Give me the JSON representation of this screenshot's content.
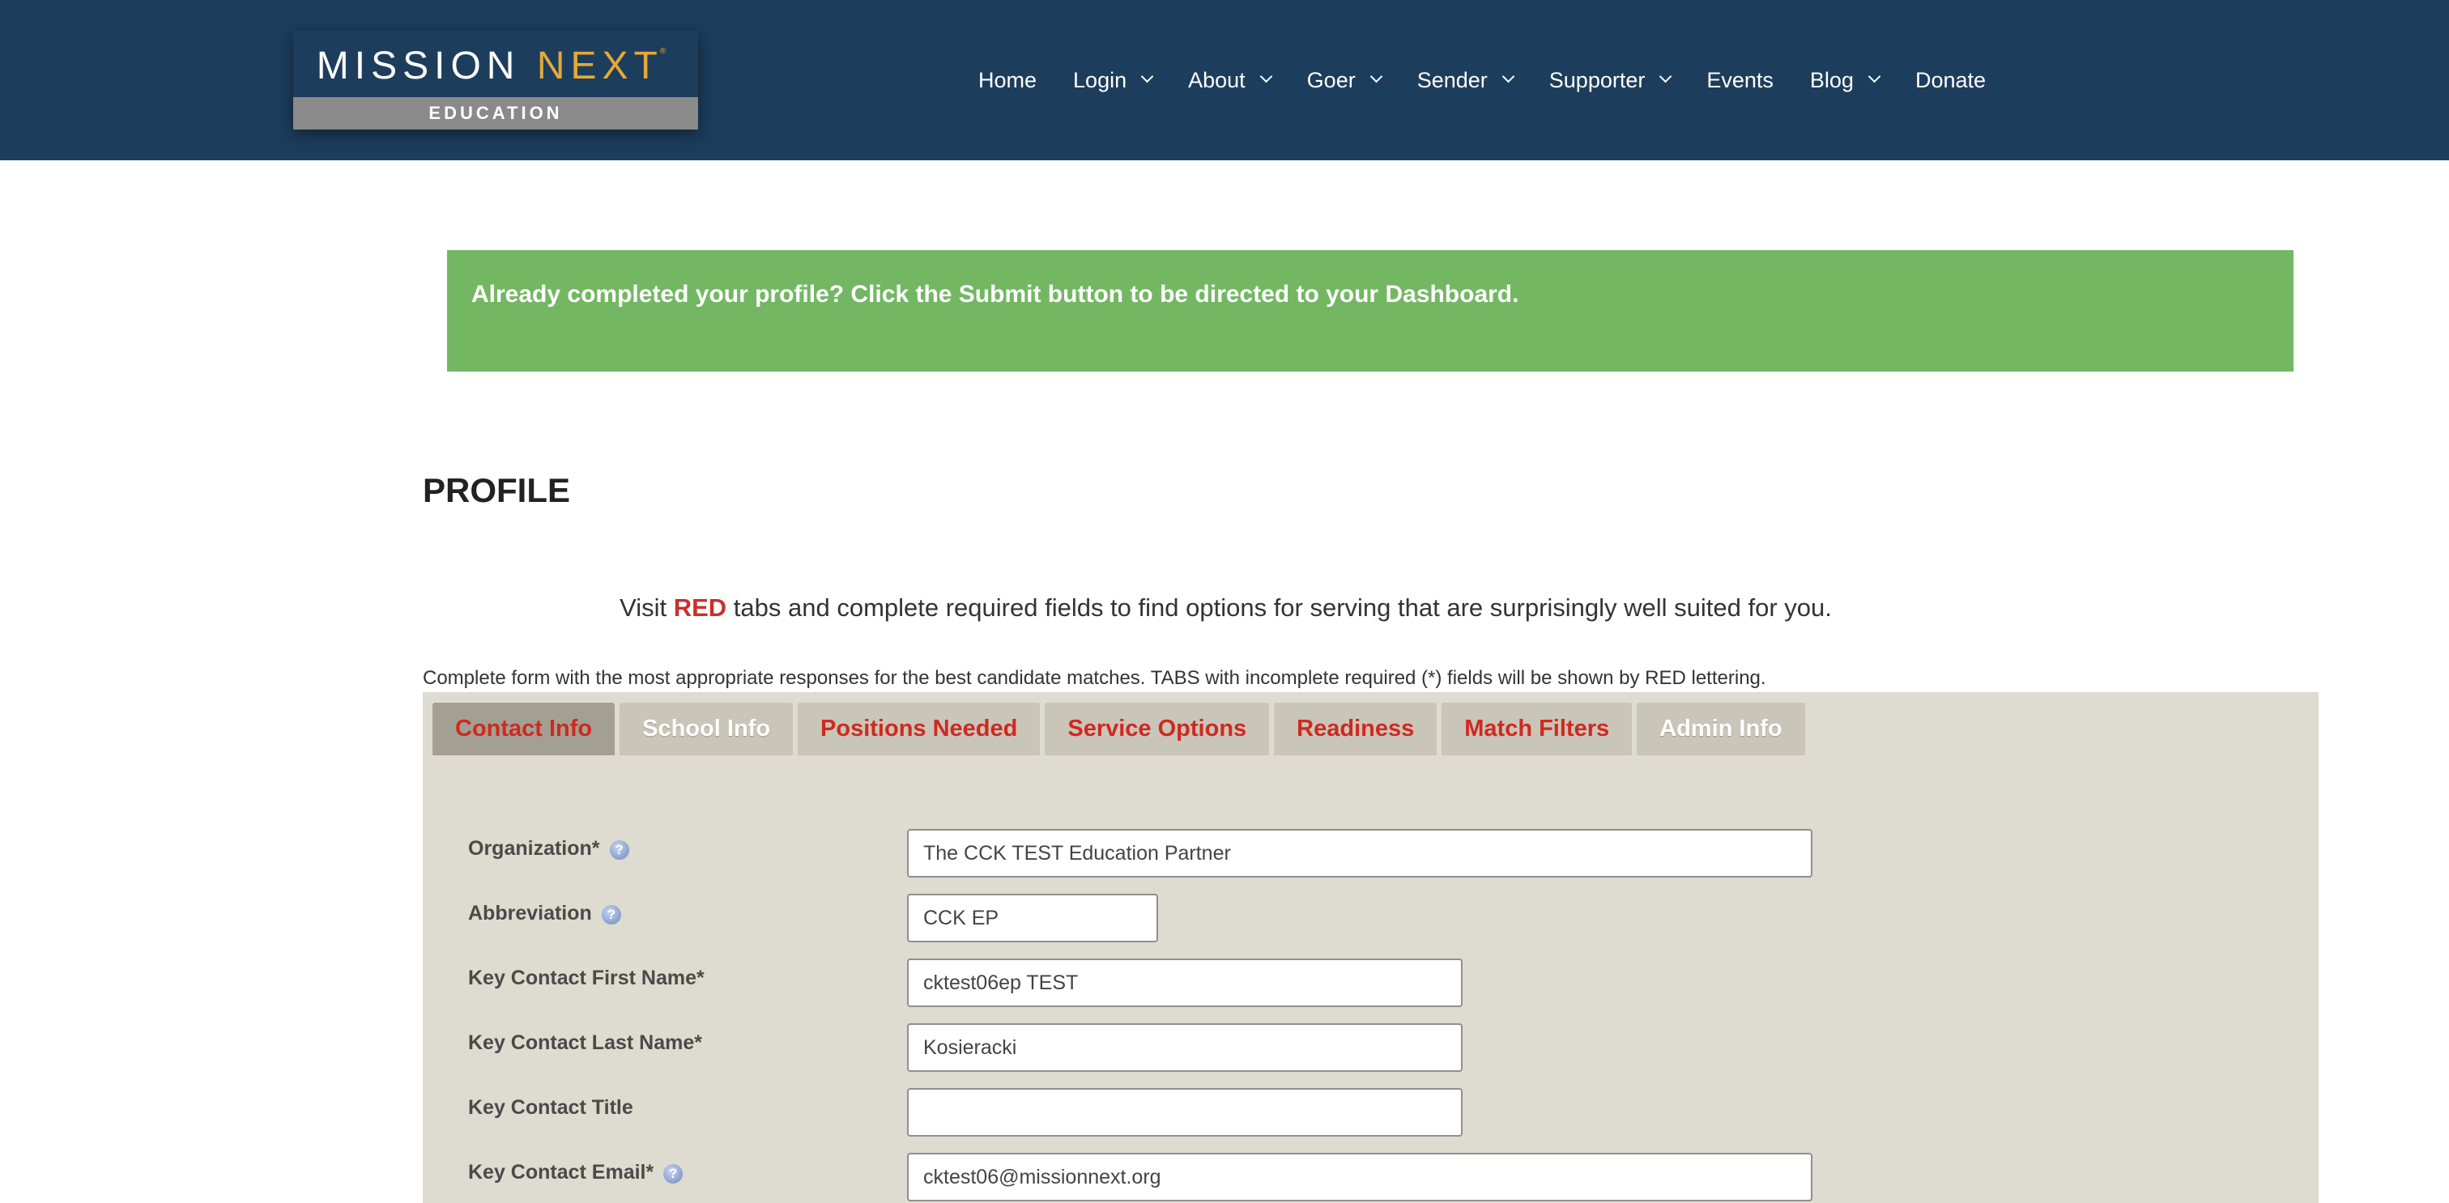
{
  "header": {
    "logo": {
      "word_main": "MISSION ",
      "word_accent": "NEXT",
      "reg": "®",
      "sub": "EDUCATION"
    },
    "nav": [
      {
        "label": "Home",
        "dropdown": false
      },
      {
        "label": "Login",
        "dropdown": true
      },
      {
        "label": "About",
        "dropdown": true
      },
      {
        "label": "Goer",
        "dropdown": true
      },
      {
        "label": "Sender",
        "dropdown": true
      },
      {
        "label": "Supporter",
        "dropdown": true
      },
      {
        "label": "Events",
        "dropdown": false
      },
      {
        "label": "Blog",
        "dropdown": true
      },
      {
        "label": "Donate",
        "dropdown": false
      }
    ]
  },
  "banner": {
    "text": "Already completed your profile? Click the Submit button to be directed to your Dashboard."
  },
  "profile": {
    "title": "PROFILE",
    "visit_pre": "Visit ",
    "visit_red": "RED",
    "visit_post": " tabs and complete required fields to find options for serving that are surprisingly well suited for you.",
    "complete_text": "Complete form with the most appropriate responses for the best candidate matches. TABS with incomplete required (*) fields will be shown by RED lettering."
  },
  "tabs": [
    {
      "label": "Contact Info",
      "style": "red",
      "active": true
    },
    {
      "label": "School Info",
      "style": "white",
      "active": false
    },
    {
      "label": "Positions Needed",
      "style": "red",
      "active": false
    },
    {
      "label": "Service Options",
      "style": "red",
      "active": false
    },
    {
      "label": "Readiness",
      "style": "red",
      "active": false
    },
    {
      "label": "Match Filters",
      "style": "red",
      "active": false
    },
    {
      "label": "Admin Info",
      "style": "white",
      "active": false
    }
  ],
  "fields": {
    "organization": {
      "label": "Organization*",
      "value": "The CCK TEST Education Partner"
    },
    "abbreviation": {
      "label": "Abbreviation",
      "value": "CCK EP"
    },
    "first_name": {
      "label": "Key Contact First Name*",
      "value": "cktest06ep TEST"
    },
    "last_name": {
      "label": "Key Contact Last Name*",
      "value": "Kosieracki"
    },
    "title": {
      "label": "Key Contact Title",
      "value": ""
    },
    "email": {
      "label": "Key Contact Email*",
      "value": "cktest06@missionnext.org"
    }
  },
  "colors": {
    "header_bg": "#1d3d5c",
    "accent_gold": "#e5a936",
    "banner_green": "#73b763",
    "required_red": "#d0281f",
    "panel_bg": "#dedbd0"
  }
}
